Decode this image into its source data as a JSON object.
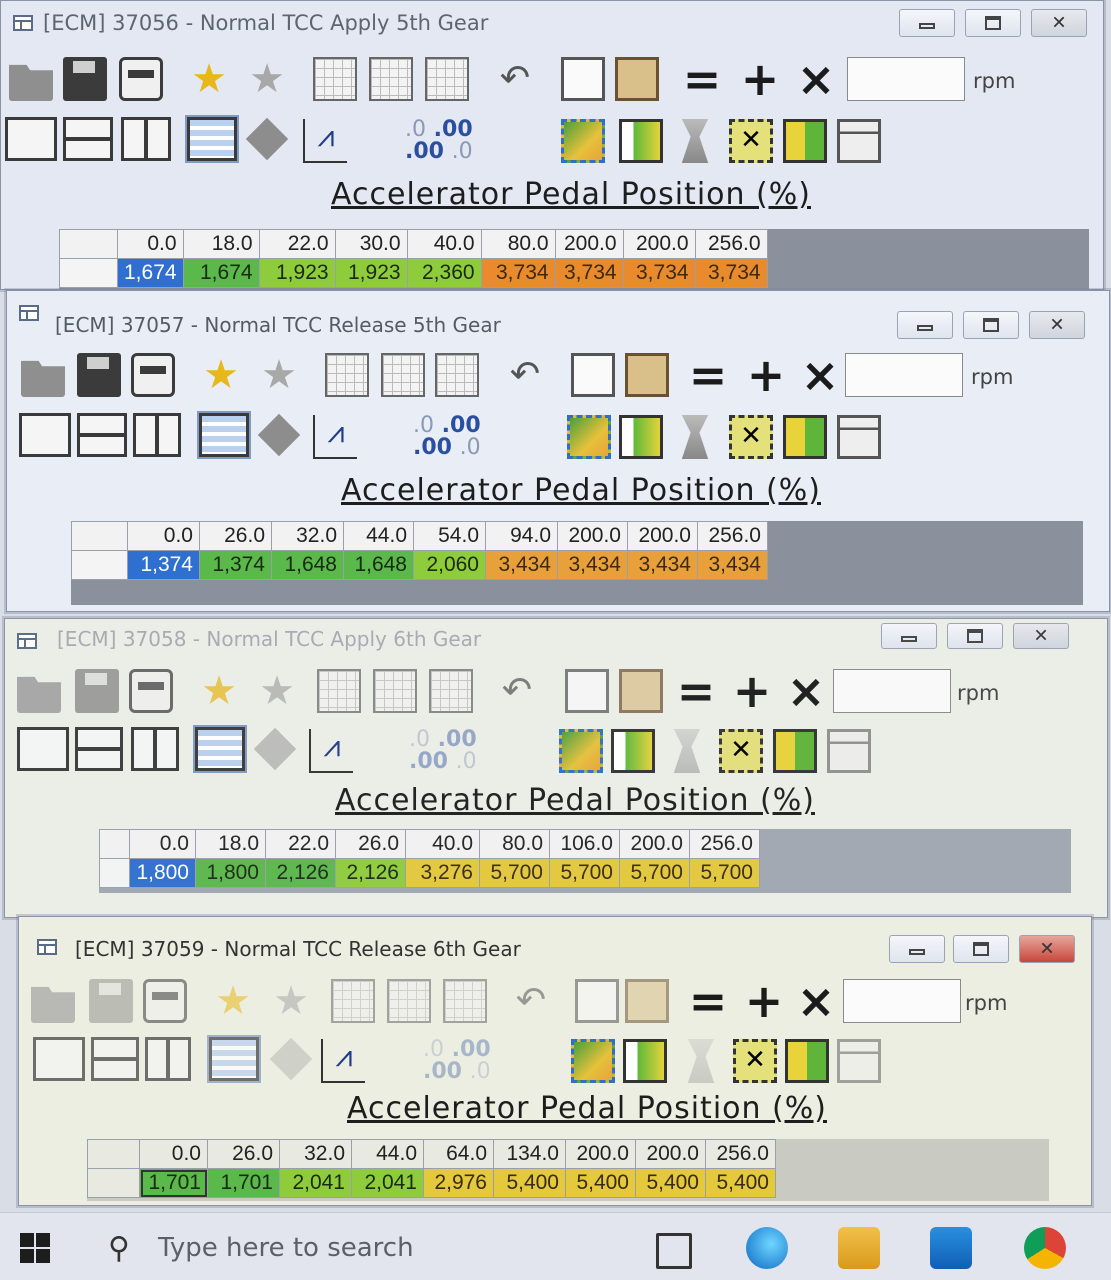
{
  "windows": [
    {
      "title": "[ECM] 37056 - Normal TCC Apply 5th Gear",
      "axis_title": "Accelerator Pedal Position (%)",
      "unit": "rpm",
      "columns": [
        "0.0",
        "18.0",
        "22.0",
        "30.0",
        "40.0",
        "80.0",
        "200.0",
        "200.0",
        "256.0"
      ],
      "values": [
        "1,674",
        "1,674",
        "1,923",
        "1,923",
        "2,360",
        "3,734",
        "3,734",
        "3,734",
        "3,734"
      ]
    },
    {
      "title": "[ECM] 37057 - Normal TCC Release 5th Gear",
      "axis_title": "Accelerator Pedal Position (%)",
      "unit": "rpm",
      "columns": [
        "0.0",
        "26.0",
        "32.0",
        "44.0",
        "54.0",
        "94.0",
        "200.0",
        "200.0",
        "256.0"
      ],
      "values": [
        "1,374",
        "1,374",
        "1,648",
        "1,648",
        "2,060",
        "3,434",
        "3,434",
        "3,434",
        "3,434"
      ]
    },
    {
      "title": "[ECM] 37058 - Normal TCC Apply 6th Gear",
      "axis_title": "Accelerator Pedal Position (%)",
      "unit": "rpm",
      "columns": [
        "0.0",
        "18.0",
        "22.0",
        "26.0",
        "40.0",
        "80.0",
        "106.0",
        "200.0",
        "256.0"
      ],
      "values": [
        "1,800",
        "1,800",
        "2,126",
        "2,126",
        "3,276",
        "5,700",
        "5,700",
        "5,700",
        "5,700"
      ]
    },
    {
      "title": "[ECM] 37059 - Normal TCC Release 6th Gear",
      "axis_title": "Accelerator Pedal Position (%)",
      "unit": "rpm",
      "columns": [
        "0.0",
        "26.0",
        "32.0",
        "44.0",
        "64.0",
        "134.0",
        "200.0",
        "200.0",
        "256.0"
      ],
      "values": [
        "1,701",
        "1,701",
        "2,041",
        "2,041",
        "2,976",
        "5,400",
        "5,400",
        "5,400",
        "5,400"
      ]
    }
  ],
  "toolbar": {
    "decimal_increase": ".0",
    "decimal_decrease": ".00"
  },
  "taskbar": {
    "search_placeholder": "Type here to search"
  },
  "colors": {
    "blue": "#2e6fd0",
    "green": "#5bb84a",
    "yellow": "#e3c93b",
    "orange": "#e8a13a"
  }
}
